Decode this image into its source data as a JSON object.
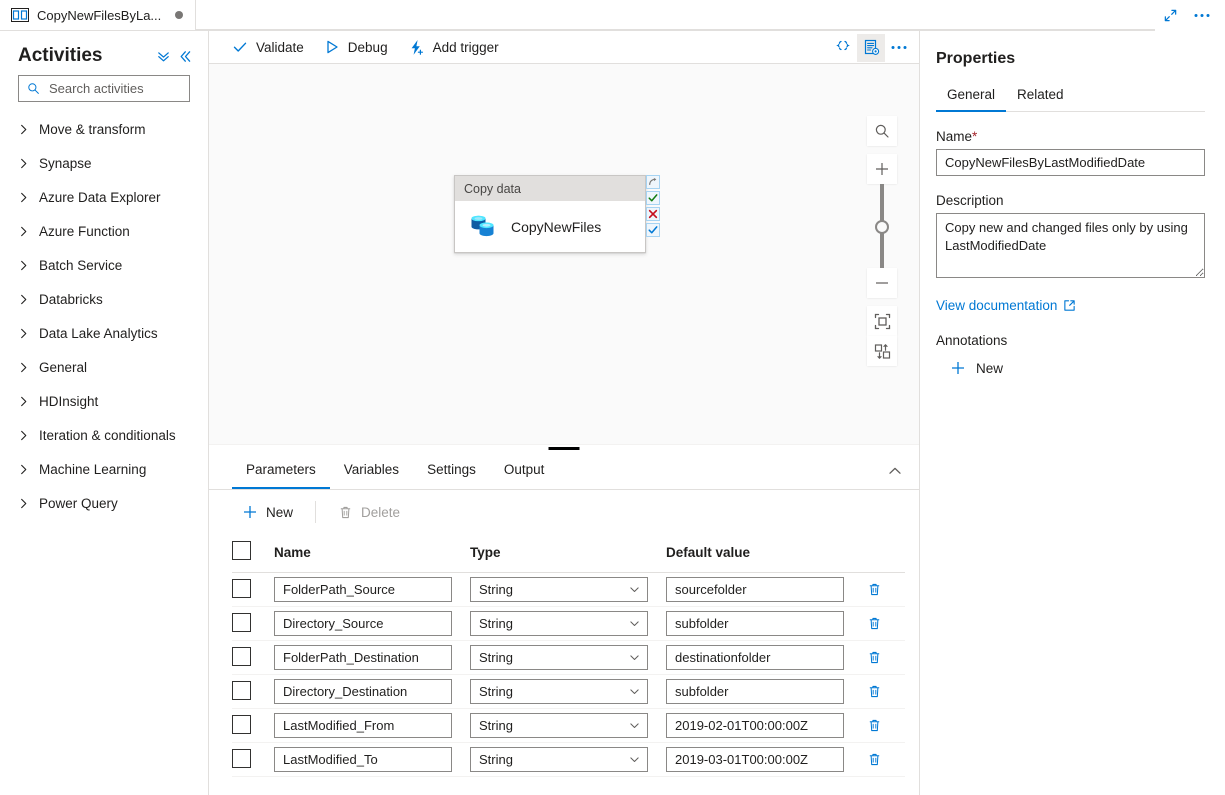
{
  "window": {
    "tab": {
      "icon": "pipeline-icon",
      "title": "CopyNewFilesByLa...",
      "dirty_indicator": "unsaved-dot"
    },
    "actions": [
      {
        "icon": "expand-icon",
        "name": "maximize"
      },
      {
        "icon": "ellipsis-icon",
        "name": "more"
      }
    ]
  },
  "activities_panel": {
    "title": "Activities",
    "header_icons": [
      {
        "icon": "collapse-all-icon",
        "name": "collapse-all"
      },
      {
        "icon": "double-chevron-left-icon",
        "name": "collapse-panel"
      }
    ],
    "search": {
      "placeholder": "Search activities",
      "value": "",
      "icon": "search-icon"
    },
    "items": [
      {
        "label": "Move & transform"
      },
      {
        "label": "Synapse"
      },
      {
        "label": "Azure Data Explorer"
      },
      {
        "label": "Azure Function"
      },
      {
        "label": "Batch Service"
      },
      {
        "label": "Databricks"
      },
      {
        "label": "Data Lake Analytics"
      },
      {
        "label": "General"
      },
      {
        "label": "HDInsight"
      },
      {
        "label": "Iteration & conditionals"
      },
      {
        "label": "Machine Learning"
      },
      {
        "label": "Power Query"
      }
    ]
  },
  "toolbar": {
    "validate_label": "Validate",
    "debug_label": "Debug",
    "add_trigger_label": "Add trigger",
    "right_icons": [
      {
        "icon": "code-braces-icon",
        "name": "code-view",
        "active": false
      },
      {
        "icon": "properties-doc-icon",
        "name": "properties-toggle",
        "active": true
      },
      {
        "icon": "ellipsis-icon",
        "name": "more-actions",
        "active": false
      }
    ]
  },
  "canvas": {
    "node": {
      "header": "Copy data",
      "label": "CopyNewFiles",
      "icon": "copy-data-icon"
    },
    "connectors": [
      {
        "name": "on-skip",
        "icon": "skip-arrow-icon",
        "color": "#797775"
      },
      {
        "name": "on-success",
        "icon": "check-icon",
        "color": "#107c10"
      },
      {
        "name": "on-failure",
        "icon": "cross-icon",
        "color": "#c50f1f"
      },
      {
        "name": "on-completion",
        "icon": "check-icon",
        "color": "#0078d4"
      }
    ],
    "controls": [
      {
        "icon": "zoom-search-icon",
        "name": "zoom-to-fit-search"
      },
      {
        "icon": "plus-icon",
        "name": "zoom-in"
      },
      {
        "icon": "zoom-slider",
        "name": "zoom-slider"
      },
      {
        "icon": "minus-icon",
        "name": "zoom-out"
      },
      {
        "icon": "fit-screen-icon",
        "name": "fit-to-screen"
      },
      {
        "icon": "auto-layout-icon",
        "name": "auto-align"
      }
    ]
  },
  "bottom_panel": {
    "tabs": [
      {
        "label": "Parameters",
        "selected": true
      },
      {
        "label": "Variables",
        "selected": false
      },
      {
        "label": "Settings",
        "selected": false
      },
      {
        "label": "Output",
        "selected": false
      }
    ],
    "collapse_icon": "chevron-up-icon",
    "actions": {
      "new_label": "New",
      "new_icon": "plus-icon",
      "delete_label": "Delete",
      "delete_icon": "trash-icon",
      "delete_disabled": true
    },
    "table": {
      "headers": [
        "Name",
        "Type",
        "Default value"
      ],
      "rows": [
        {
          "name": "FolderPath_Source",
          "type": "String",
          "default_value": "sourcefolder",
          "checked": false
        },
        {
          "name": "Directory_Source",
          "type": "String",
          "default_value": "subfolder",
          "checked": false
        },
        {
          "name": "FolderPath_Destination",
          "type": "String",
          "default_value": "destinationfolder",
          "checked": false
        },
        {
          "name": "Directory_Destination",
          "type": "String",
          "default_value": "subfolder",
          "checked": false
        },
        {
          "name": "LastModified_From",
          "type": "String",
          "default_value": "2019-02-01T00:00:00Z",
          "checked": false
        },
        {
          "name": "LastModified_To",
          "type": "String",
          "default_value": "2019-03-01T00:00:00Z",
          "checked": false
        }
      ],
      "row_delete_icon": "trash-icon"
    }
  },
  "properties": {
    "title": "Properties",
    "tabs": [
      {
        "label": "General",
        "selected": true
      },
      {
        "label": "Related",
        "selected": false
      }
    ],
    "name_label": "Name",
    "name_required_mark": "*",
    "name_value": "CopyNewFilesByLastModifiedDate",
    "description_label": "Description",
    "description_value": "Copy new and changed files only by using LastModifiedDate",
    "documentation_link": "View documentation",
    "documentation_icon": "external-link-icon",
    "annotations_label": "Annotations",
    "annotations_new_label": "New",
    "annotations_new_icon": "plus-icon"
  },
  "colors": {
    "accent": "#0078d4",
    "success": "#107c10",
    "error": "#c50f1f",
    "required": "#a4262c",
    "panel_border": "#e1dfdd"
  }
}
